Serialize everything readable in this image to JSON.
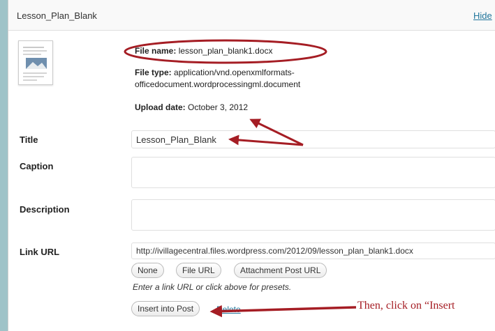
{
  "header": {
    "title": "Lesson_Plan_Blank",
    "hide_label": "Hide"
  },
  "file_info": {
    "file_name_label": "File name:",
    "file_name": "lesson_plan_blank1.docx",
    "file_type_label": "File type:",
    "file_type_line1": "application/vnd.openxmlformats-",
    "file_type_line2": "officedocument.wordprocessingml.document",
    "upload_date_label": "Upload date:",
    "upload_date": "October 3, 2012"
  },
  "form": {
    "title_label": "Title",
    "title_value": "Lesson_Plan_Blank",
    "caption_label": "Caption",
    "caption_value": "",
    "description_label": "Description",
    "description_value": "",
    "link_url_label": "Link URL",
    "link_url_value": "http://ivillagecentral.files.wordpress.com/2012/09/lesson_plan_blank1.docx",
    "buttons": {
      "none": "None",
      "file_url": "File URL",
      "attachment_post_url": "Attachment Post URL"
    },
    "help_text": "Enter a link URL or click above for presets.",
    "insert_button": "Insert into Post",
    "delete_label": "Delete"
  },
  "annotation": {
    "callout": "Then, click on “Insert",
    "color": "#a51d24"
  }
}
